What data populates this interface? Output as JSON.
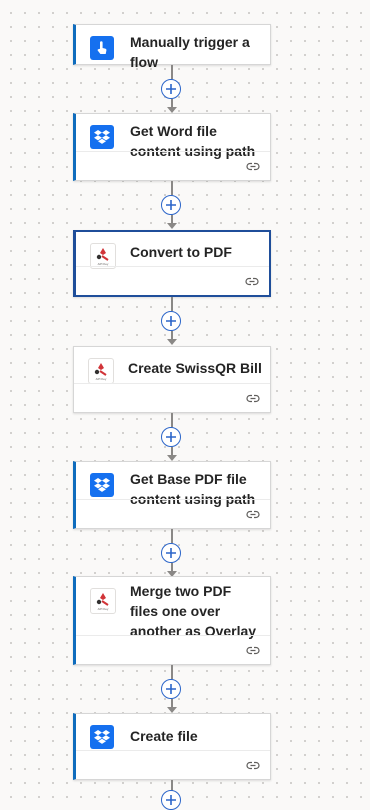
{
  "flow": {
    "steps": [
      {
        "title": "Manually trigger a flow",
        "icon": "manual-trigger-icon",
        "connector": "manual-trigger"
      },
      {
        "title": "Get Word file content using path",
        "icon": "dropbox-icon",
        "connector": "dropbox"
      },
      {
        "title": "Convert to PDF",
        "icon": "api-key-icon",
        "connector": "api-key"
      },
      {
        "title": "Create SwissQR Bill",
        "icon": "api-key-icon",
        "connector": "api-key"
      },
      {
        "title": "Get Base PDF file content using path",
        "icon": "dropbox-icon",
        "connector": "dropbox"
      },
      {
        "title": "Merge two PDF files one over another as Overlay",
        "icon": "api-key-icon",
        "connector": "api-key"
      },
      {
        "title": "Create file",
        "icon": "dropbox-icon",
        "connector": "dropbox"
      }
    ],
    "link_icon_name": "link-icon",
    "add_icon_name": "plus-icon"
  },
  "colors": {
    "accent": "#0f6cbd",
    "selected_border": "#1f4e9a",
    "dropbox_blue": "#1570ef",
    "add_button_border": "#2b65c9"
  }
}
